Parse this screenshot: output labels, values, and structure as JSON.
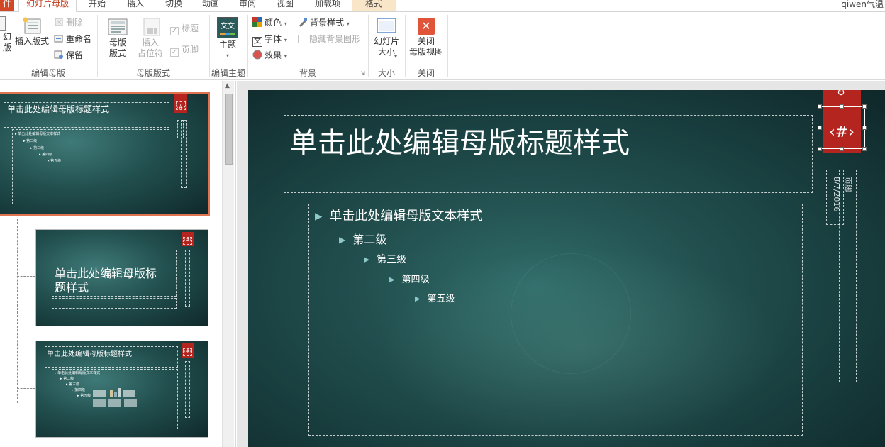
{
  "tabs": {
    "file": "件",
    "slide_master": "幻灯片母版",
    "home": "开始",
    "insert": "插入",
    "transitions": "切换",
    "animations": "动画",
    "review": "审阅",
    "view": "视图",
    "addins": "加载项",
    "format": "格式",
    "user": "qiwen气温"
  },
  "ribbon": {
    "edit_master": {
      "insert_slide_master": "幻\n版",
      "insert_layout": "插入版式",
      "delete": "删除",
      "rename": "重命名",
      "preserve": "保留",
      "label": "编辑母版"
    },
    "master_layout": {
      "master_layout": "母版\n版式",
      "insert_placeholder": "插入\n占位符",
      "title": "标题",
      "footers": "页脚",
      "label": "母版版式"
    },
    "edit_theme": {
      "themes": "主题",
      "theme_icon_text": "文文",
      "label": "编辑主题"
    },
    "background": {
      "colors": "颜色",
      "fonts": "字体",
      "effects": "效果",
      "background_styles": "背景样式",
      "hide_background_graphics": "隐藏背景图形",
      "label": "背景"
    },
    "size": {
      "slide_size": "幻灯片\n大小",
      "label": "大小"
    },
    "close": {
      "close_master_view": "关闭\n母版视图",
      "label": "关闭"
    }
  },
  "thumbnails": {
    "t1_title": "单击此处编辑母版标题样式",
    "t1_body": [
      "单击此处编辑母版文本样式",
      "第二级",
      "第三级",
      "第四级",
      "第五级"
    ],
    "t1_num": "‹#›",
    "t2_title": "单击此处编辑母版标\n题样式",
    "t2_num": "‹#›",
    "t3_title": "单击此处编辑母版标题样式",
    "t3_body": [
      "单击此处编辑母版文本样式",
      "第二级",
      "第三级",
      "第四级",
      "第五级"
    ],
    "t3_num": "‹#›"
  },
  "slide": {
    "title": "单击此处编辑母版标题样式",
    "levels": [
      "单击此处编辑母版文本样式",
      "第二级",
      "第三级",
      "第四级",
      "第五级"
    ],
    "number": "‹#›",
    "date": "8/7/2016",
    "footer": "页脚"
  },
  "colors": {
    "accent": "#c43e1c",
    "file_tab": "#d24726",
    "slide_bg": "#22504f",
    "red_tag": "#b52520",
    "close_icon": "#e0553a"
  }
}
